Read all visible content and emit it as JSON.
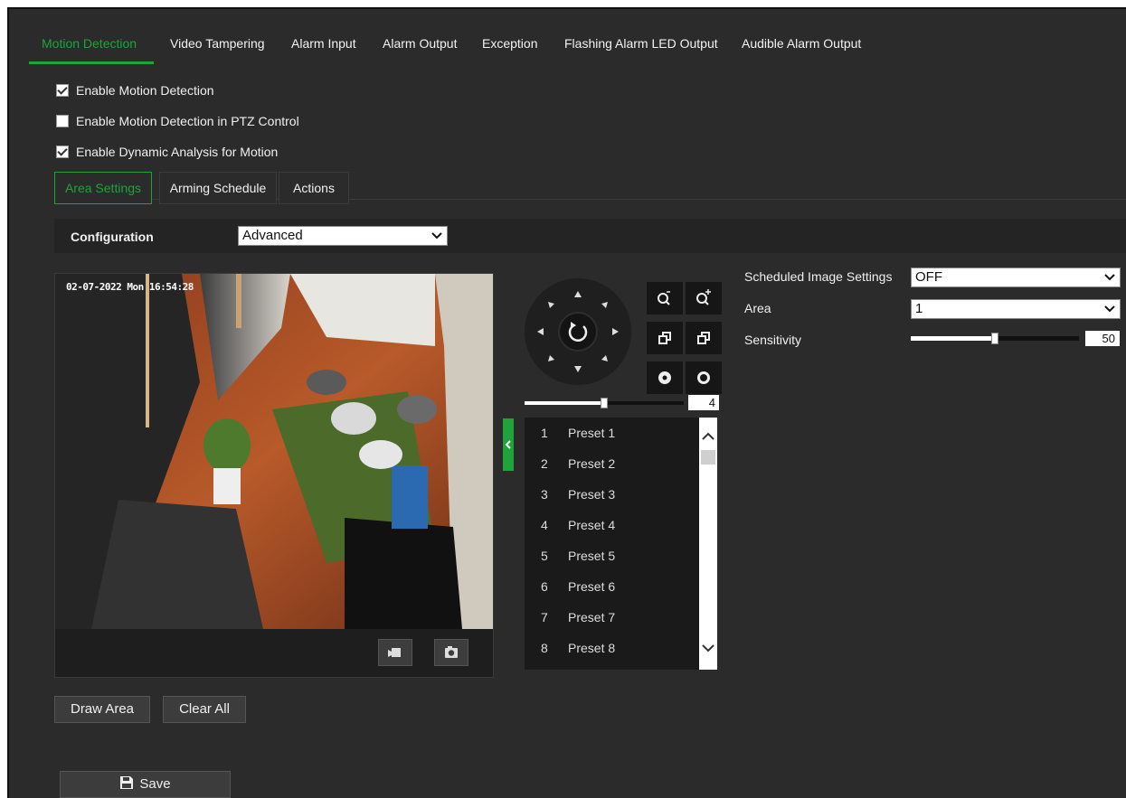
{
  "top_tabs": [
    {
      "label": "Motion Detection",
      "active": true
    },
    {
      "label": "Video Tampering",
      "active": false
    },
    {
      "label": "Alarm Input",
      "active": false
    },
    {
      "label": "Alarm Output",
      "active": false
    },
    {
      "label": "Exception",
      "active": false
    },
    {
      "label": "Flashing Alarm LED Output",
      "active": false
    },
    {
      "label": "Audible Alarm Output",
      "active": false
    }
  ],
  "options": [
    {
      "label": "Enable Motion Detection",
      "checked": true
    },
    {
      "label": "Enable Motion Detection in PTZ Control",
      "checked": false
    },
    {
      "label": "Enable Dynamic Analysis for Motion",
      "checked": true
    }
  ],
  "sub_tabs": [
    {
      "label": "Area Settings",
      "active": true
    },
    {
      "label": "Arming Schedule",
      "active": false
    },
    {
      "label": "Actions",
      "active": false
    }
  ],
  "configuration": {
    "label": "Configuration",
    "value": "Advanced"
  },
  "video": {
    "timestamp": "02-07-2022 Mon 16:54:28"
  },
  "ptz": {
    "speed_value": "4",
    "speed_level": 0.5
  },
  "presets": [
    {
      "num": "1",
      "name": "Preset 1"
    },
    {
      "num": "2",
      "name": "Preset 2"
    },
    {
      "num": "3",
      "name": "Preset 3"
    },
    {
      "num": "4",
      "name": "Preset 4"
    },
    {
      "num": "5",
      "name": "Preset 5"
    },
    {
      "num": "6",
      "name": "Preset 6"
    },
    {
      "num": "7",
      "name": "Preset 7"
    },
    {
      "num": "8",
      "name": "Preset 8"
    }
  ],
  "settings": {
    "scheduled_label": "Scheduled Image Settings",
    "scheduled_value": "OFF",
    "area_label": "Area",
    "area_value": "1",
    "sensitivity_label": "Sensitivity",
    "sensitivity_value": "50",
    "sensitivity_level": 0.5
  },
  "buttons": {
    "draw_area": "Draw Area",
    "clear_all": "Clear All",
    "save": "Save"
  },
  "colors": {
    "accent": "#1fa33a",
    "background": "#2b2b2b"
  }
}
